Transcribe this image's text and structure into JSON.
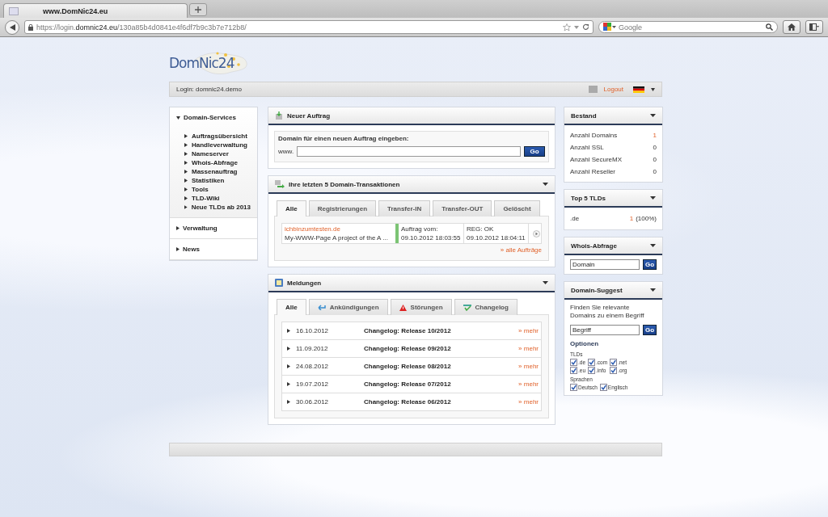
{
  "browser": {
    "tab_title": "www.DomNic24.eu",
    "url": "https://login.**domnic24.eu**/130a85b4d0841e4f6df7b9c3b7e712b8/",
    "search_placeholder": "Google"
  },
  "logo": "DomNic24",
  "login_bar": {
    "login": "Login: domnic24.demo",
    "logout": "Logout"
  },
  "sidebar": {
    "items": [
      {
        "label": "Domain-Services",
        "expanded": true,
        "children": [
          {
            "label": "Auftragsübersicht"
          },
          {
            "label": "Handleverwaltung"
          },
          {
            "label": "Nameserver"
          },
          {
            "label": "Whois-Abfrage"
          },
          {
            "label": "Massenauftrag"
          },
          {
            "label": "Statistiken"
          },
          {
            "label": "Tools"
          },
          {
            "label": "TLD-Wiki"
          },
          {
            "label": "Neue TLDs ab 2013"
          }
        ]
      },
      {
        "label": "Verwaltung",
        "expanded": false
      },
      {
        "label": "News",
        "expanded": false
      }
    ]
  },
  "new_order": {
    "title": "Neuer Auftrag",
    "prompt": "Domain für einen neuen Auftrag eingeben:",
    "prefix": "www.",
    "button": "Go"
  },
  "transactions": {
    "title": "Ihre letzten 5 Domain-Transaktionen",
    "tabs": [
      {
        "label": "Alle",
        "selected": true
      },
      {
        "label": "Registrierungen",
        "selected": false
      },
      {
        "label": "Transfer-IN",
        "selected": false
      },
      {
        "label": "Transfer-OUT",
        "selected": false
      },
      {
        "label": "Gelöscht",
        "selected": false
      }
    ],
    "rows": [
      {
        "domain": "ichbinzumtesten.de",
        "description": "My-WWW-Page A project of the A ...",
        "color": "#7cc474",
        "order_label": "Auftrag vom:",
        "order_date": "09.10.2012 18:03:55",
        "status": "REG: OK",
        "status_date": "09.10.2012 18:04:11"
      }
    ],
    "all_link": "» alle Aufträge"
  },
  "messages": {
    "title": "Meldungen",
    "tabs": [
      {
        "label": "Alle",
        "kind": "all",
        "selected": true
      },
      {
        "label": "Ankündigungen",
        "kind": "announcement",
        "selected": false
      },
      {
        "label": "Störungen",
        "kind": "warning",
        "selected": false
      },
      {
        "label": "Changelog",
        "kind": "changelog",
        "selected": false
      }
    ],
    "rows": [
      {
        "date": "16.10.2012",
        "title": "Changelog: Release 10/2012",
        "link": "» mehr"
      },
      {
        "date": "11.09.2012",
        "title": "Changelog: Release 09/2012",
        "link": "» mehr"
      },
      {
        "date": "24.08.2012",
        "title": "Changelog: Release 08/2012",
        "link": "» mehr"
      },
      {
        "date": "19.07.2012",
        "title": "Changelog: Release 07/2012",
        "link": "» mehr"
      },
      {
        "date": "30.06.2012",
        "title": "Changelog: Release 06/2012",
        "link": "» mehr"
      }
    ]
  },
  "stock": {
    "title": "Bestand",
    "rows": [
      {
        "label": "Anzahl Domains",
        "value": "1",
        "link": true
      },
      {
        "label": "Anzahl SSL",
        "value": "0",
        "link": false
      },
      {
        "label": "Anzahl SecureMX",
        "value": "0",
        "link": false
      },
      {
        "label": "Anzahl Reseller",
        "value": "0",
        "link": false
      }
    ]
  },
  "top_tlds": {
    "title": "Top 5 TLDs",
    "rows": [
      {
        "tld": ".de",
        "count": "1",
        "share": "(100%)"
      }
    ]
  },
  "whois": {
    "title": "Whois-Abfrage",
    "placeholder": "Domain",
    "button": "Go"
  },
  "suggest": {
    "title": "Domain-Suggest",
    "text": "Finden Sie relevante Domains zu einem Begriff",
    "placeholder": "Begriff",
    "button": "Go",
    "options_title": "Optionen",
    "groups": [
      {
        "label": "TLDs",
        "options": [
          {
            "label": ".de",
            "checked": true
          },
          {
            "label": ".com",
            "checked": true
          },
          {
            "label": ".net",
            "checked": true
          },
          {
            "label": ".eu",
            "checked": true
          },
          {
            "label": ".info",
            "checked": true
          },
          {
            "label": ".org",
            "checked": true
          }
        ]
      },
      {
        "label": "Sprachen",
        "options": [
          {
            "label": "Deutsch",
            "checked": true
          },
          {
            "label": "Englisch",
            "checked": true
          }
        ]
      }
    ]
  }
}
